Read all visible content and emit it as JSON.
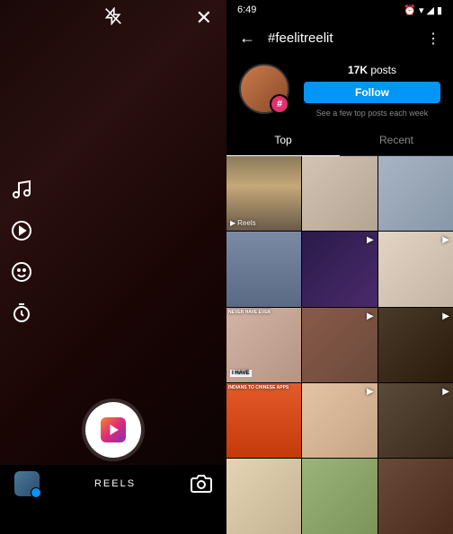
{
  "left": {
    "mode_label": "REELS"
  },
  "right": {
    "status": {
      "time": "6:49"
    },
    "header": {
      "hashtag": "#feelitreelit"
    },
    "profile": {
      "post_count": "17K",
      "post_label": "posts",
      "follow_label": "Follow",
      "see_more": "See a few top posts each week"
    },
    "tabs": {
      "top": "Top",
      "recent": "Recent"
    },
    "grid": {
      "reels_label": "Reels",
      "overlay_7": "NEVER HAVE EVER",
      "overlay_7b": "I HAVE",
      "overlay_10": "INDIANS TO CHINESE APPS"
    }
  }
}
